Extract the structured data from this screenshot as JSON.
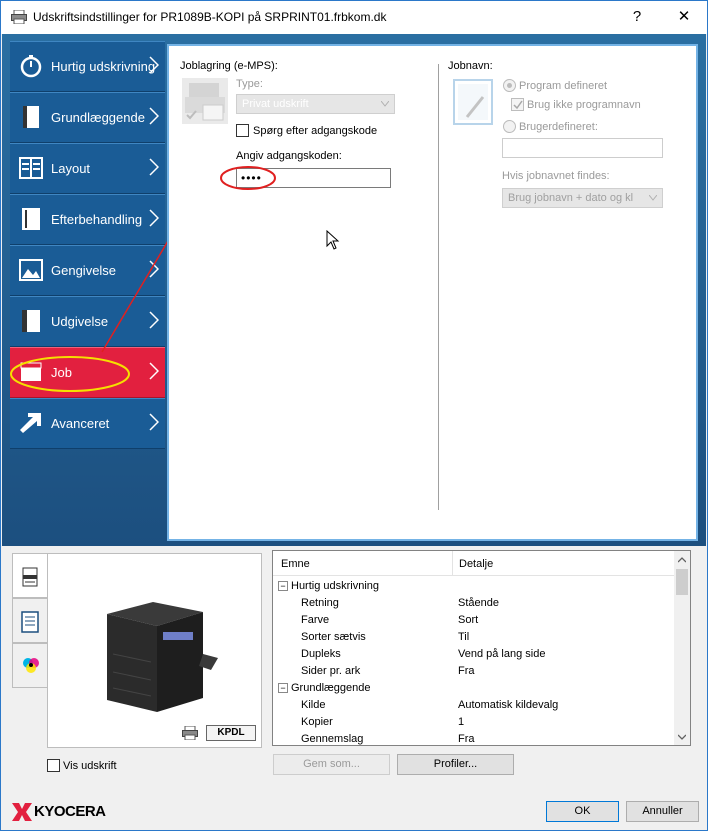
{
  "window": {
    "title": "Udskriftsindstillinger for PR1089B-KOPI på SRPRINT01.frbkom.dk",
    "help": "?",
    "close": "✕"
  },
  "nav": {
    "items": [
      {
        "label": "Hurtig udskrivning",
        "icon": "stopwatch-icon"
      },
      {
        "label": "Grundlæggende",
        "icon": "page-icon"
      },
      {
        "label": "Layout",
        "icon": "layout-icon"
      },
      {
        "label": "Efterbehandling",
        "icon": "finishing-icon"
      },
      {
        "label": "Gengivelse",
        "icon": "image-icon"
      },
      {
        "label": "Udgivelse",
        "icon": "booklet-icon"
      },
      {
        "label": "Job",
        "icon": "job-icon",
        "active": true
      },
      {
        "label": "Avanceret",
        "icon": "arrow-icon"
      }
    ]
  },
  "job": {
    "storage_label": "Joblagring (e-MPS):",
    "type_label": "Type:",
    "type_value": "Privat udskrift",
    "ask_code_label": "Spørg efter adgangskode",
    "code_label": "Angiv adgangskoden:",
    "code_value": "••••",
    "jobname_label": "Jobnavn:",
    "program_defined": "Program defineret",
    "no_program_name": "Brug ikke programnavn",
    "user_defined": "Brugerdefineret:",
    "if_exists_label": "Hvis jobnavnet findes:",
    "if_exists_value": "Brug jobnavn + dato og kl"
  },
  "summary": {
    "col_topic": "Emne",
    "col_detail": "Detalje",
    "rows": [
      {
        "group": true,
        "label": "Hurtig udskrivning"
      },
      {
        "label": "Retning",
        "value": "Stående"
      },
      {
        "label": "Farve",
        "value": "Sort"
      },
      {
        "label": "Sorter sætvis",
        "value": "Til"
      },
      {
        "label": "Dupleks",
        "value": "Vend på lang side"
      },
      {
        "label": "Sider pr. ark",
        "value": "Fra"
      },
      {
        "group": true,
        "label": "Grundlæggende"
      },
      {
        "label": "Kilde",
        "value": "Automatisk kildevalg"
      },
      {
        "label": "Kopier",
        "value": "1"
      },
      {
        "label": "Gennemslag",
        "value": "Fra"
      }
    ]
  },
  "preview": {
    "show_print_label": "Vis udskrift",
    "kpdl": "KPDL"
  },
  "buttons": {
    "save_as": "Gem som...",
    "profiles": "Profiler...",
    "ok": "OK",
    "cancel": "Annuller"
  },
  "brand": {
    "name": "KYOCERA",
    "color": "#e2203f"
  }
}
